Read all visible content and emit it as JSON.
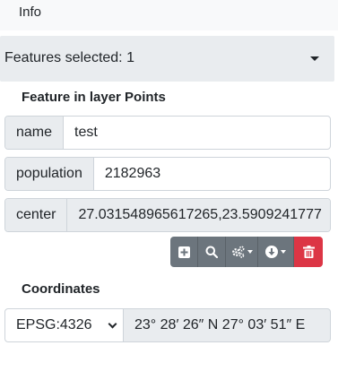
{
  "header": {
    "tab_label": "Info"
  },
  "selection": {
    "label": "Features selected: 1"
  },
  "feature": {
    "title": "Feature in layer Points",
    "attributes": [
      {
        "key": "name",
        "value": "test"
      },
      {
        "key": "population",
        "value": "2182963"
      },
      {
        "key": "center",
        "value": "27.031548965617265,23.5909241777"
      }
    ]
  },
  "toolbar": {
    "buttons": [
      {
        "name": "add",
        "icon": "plus-square-icon"
      },
      {
        "name": "zoom",
        "icon": "search-icon"
      },
      {
        "name": "tools",
        "icon": "cogs-icon",
        "dropdown": true
      },
      {
        "name": "download",
        "icon": "download-icon",
        "dropdown": true
      },
      {
        "name": "delete",
        "icon": "trash-icon",
        "color": "#dc3545"
      }
    ]
  },
  "coordinates": {
    "title": "Coordinates",
    "crs_selected": "EPSG:4326",
    "value": "23° 28′ 26″ N 27° 03′ 51″ E"
  },
  "colors": {
    "muted_bg": "#e9ecef",
    "button_secondary": "#6c757d",
    "button_danger": "#dc3545"
  }
}
